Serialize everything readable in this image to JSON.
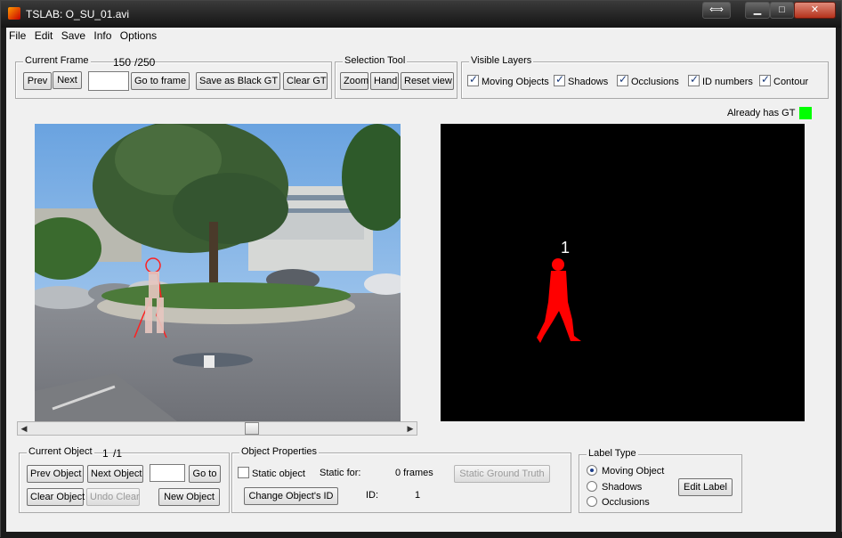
{
  "window": {
    "title": "TSLAB: O_SU_01.avi"
  },
  "menu": [
    "File",
    "Edit",
    "Save",
    "Info",
    "Options"
  ],
  "current_frame": {
    "label": "Current Frame",
    "frame_number": "150",
    "frame_total": "/250",
    "prev": "Prev",
    "next": "Next",
    "frame_input_value": "",
    "go_to_frame": "Go to frame",
    "save_black_gt": "Save as Black GT",
    "clear_gt": "Clear GT"
  },
  "selection_tool": {
    "label": "Selection Tool",
    "zoom": "Zoom",
    "hand": "Hand",
    "reset_view": "Reset view"
  },
  "visible_layers": {
    "label": "Visible Layers",
    "items": [
      {
        "label": "Moving Objects",
        "checked": true
      },
      {
        "label": "Shadows",
        "checked": true
      },
      {
        "label": "Occlusions",
        "checked": true
      },
      {
        "label": "ID numbers",
        "checked": true
      },
      {
        "label": "Contour",
        "checked": true
      }
    ]
  },
  "gt_status": {
    "label": "Already has GT",
    "color": "#00ff00"
  },
  "mask_view": {
    "object_id_label": "1",
    "mask_color": "#ff0000"
  },
  "frame_scroll": {
    "position": 0.59
  },
  "current_object": {
    "label": "Current Object",
    "index": "1",
    "total": "/1",
    "prev_object": "Prev Object",
    "next_object": "Next Object",
    "input_value": "",
    "go_to": "Go to",
    "clear_object": "Clear Object",
    "undo_clear": "Undo Clear",
    "new_object": "New Object"
  },
  "object_properties": {
    "label": "Object Properties",
    "static_object": "Static object",
    "static_object_checked": false,
    "static_for_label": "Static for:",
    "static_for_value": "0 frames",
    "static_gt_button": "Static Ground Truth",
    "change_id_button": "Change Object's ID",
    "id_label": "ID:",
    "id_value": "1"
  },
  "label_type": {
    "label": "Label Type",
    "options": [
      {
        "label": "Moving Object",
        "selected": true
      },
      {
        "label": "Shadows",
        "selected": false
      },
      {
        "label": "Occlusions",
        "selected": false
      }
    ],
    "edit_label": "Edit Label"
  }
}
